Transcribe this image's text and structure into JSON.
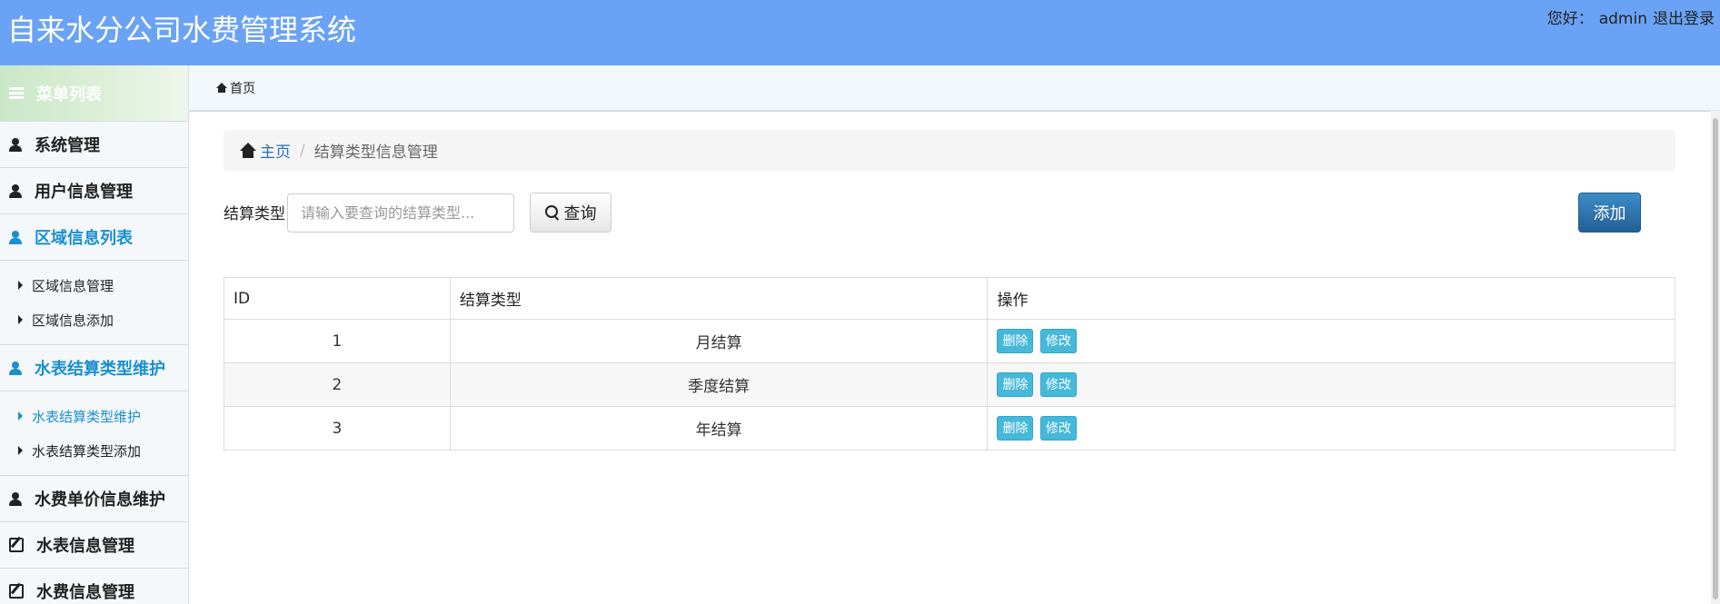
{
  "header": {
    "title": "自来水分公司水费管理系统",
    "greeting": "您好：",
    "username": "admin",
    "logout": "退出登录"
  },
  "sidebar": {
    "menu_title": "菜单列表",
    "groups": [
      {
        "label": "系统管理",
        "icon": "user-icon"
      },
      {
        "label": "用户信息管理",
        "icon": "user-icon"
      },
      {
        "label": "区域信息列表",
        "icon": "user-icon",
        "active": true
      },
      {
        "label": "水表结算类型维护",
        "icon": "user-icon",
        "active": true
      },
      {
        "label": "水费单价信息维护",
        "icon": "user-icon"
      },
      {
        "label": "水表信息管理",
        "icon": "edit-icon"
      },
      {
        "label": "水费信息管理",
        "icon": "edit-icon"
      }
    ],
    "region_sub": [
      "区域信息管理",
      "区域信息添加"
    ],
    "meter_sub": [
      "水表结算类型维护",
      "水表结算类型添加"
    ]
  },
  "topnav": {
    "home": "首页"
  },
  "breadcrumb": {
    "home": "主页",
    "separator": "/",
    "current": "结算类型信息管理"
  },
  "search": {
    "label": "结算类型",
    "placeholder": "请输入要查询的结算类型...",
    "button": "查询"
  },
  "add_button": "添加",
  "table": {
    "headers": [
      "ID",
      "结算类型",
      "操作"
    ],
    "rows": [
      {
        "id": "1",
        "type": "月结算"
      },
      {
        "id": "2",
        "type": "季度结算"
      },
      {
        "id": "3",
        "type": "年结算"
      }
    ],
    "delete_label": "删除",
    "edit_label": "修改"
  },
  "colors": {
    "header_bg": "#6aa3f5",
    "active": "#1a8fd0",
    "add_button": "#2a6ea8",
    "op_button": "#46b8da"
  }
}
